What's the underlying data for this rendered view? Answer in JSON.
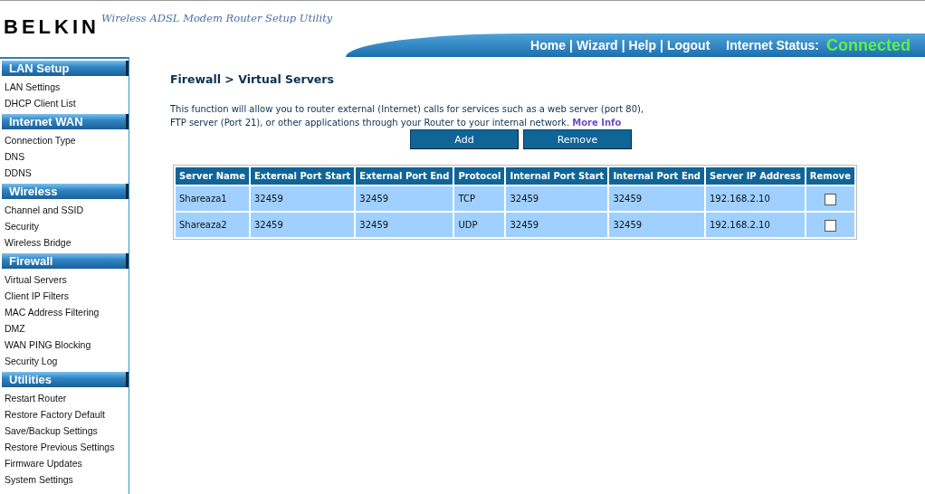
{
  "header": {
    "logo": "BELKIN",
    "subtitle": "Wireless ADSL Modem Router Setup Utility",
    "nav": [
      "Home",
      "Wizard",
      "Help",
      "Logout"
    ],
    "separator": "|",
    "status_label": "Internet Status:",
    "status_value": "Connected",
    "connected": true
  },
  "sidebar": [
    {
      "title": "LAN Setup",
      "items": [
        {
          "label": "LAN Settings",
          "selected": false
        },
        {
          "label": "DHCP Client List",
          "selected": false
        }
      ]
    },
    {
      "title": "Internet WAN",
      "items": [
        {
          "label": "Connection Type",
          "selected": false
        },
        {
          "label": "DNS",
          "selected": false
        },
        {
          "label": "DDNS",
          "selected": false
        }
      ]
    },
    {
      "title": "Wireless",
      "items": [
        {
          "label": "Channel and SSID",
          "selected": false
        },
        {
          "label": "Security",
          "selected": false
        },
        {
          "label": "Wireless Bridge",
          "selected": false
        }
      ]
    },
    {
      "title": "Firewall",
      "items": [
        {
          "label": "Virtual Servers",
          "selected": false
        },
        {
          "label": "Client IP Filters",
          "selected": false
        },
        {
          "label": "MAC Address Filtering",
          "selected": false
        },
        {
          "label": "DMZ",
          "selected": false
        },
        {
          "label": "WAN PING Blocking",
          "selected": false
        },
        {
          "label": "Security Log",
          "selected": false
        }
      ]
    },
    {
      "title": "Utilities",
      "items": [
        {
          "label": "Restart Router",
          "selected": false
        },
        {
          "label": "Restore Factory Default",
          "selected": false
        },
        {
          "label": "Save/Backup Settings",
          "selected": false
        },
        {
          "label": "Restore Previous Settings",
          "selected": false
        },
        {
          "label": "Firmware Updates",
          "selected": false
        },
        {
          "label": "System Settings",
          "selected": false
        }
      ]
    }
  ],
  "page": {
    "title": "Firewall > Virtual Servers",
    "description": "This function will allow you to router external (Internet) calls for services such as a web server (port 80), FTP server (Port 21), or other applications through your Router to your internal network.",
    "more_info": "More Info",
    "buttons": [
      "Add",
      "Remove"
    ]
  },
  "table": {
    "columns": [
      "Server Name",
      "External Port Start",
      "External Port End",
      "Protocol",
      "Internal Port Start",
      "Internal Port End",
      "Server IP Address",
      "Remove"
    ],
    "rows": [
      {
        "cells": [
          "Shareaza1",
          "32459",
          "32459",
          "TCP",
          "32459",
          "32459",
          "192.168.2.10"
        ],
        "checked": false
      },
      {
        "cells": [
          "Shareaza2",
          "32459",
          "32459",
          "UDP",
          "32459",
          "32459",
          "192.168.2.10"
        ],
        "checked": false
      }
    ]
  }
}
